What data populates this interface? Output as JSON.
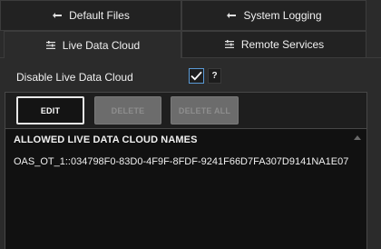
{
  "tabs": {
    "default_files": {
      "label": "Default Files",
      "icon": "gear-icon"
    },
    "system_logging": {
      "label": "System Logging",
      "icon": "gear-icon"
    },
    "live_data_cloud": {
      "label": "Live Data Cloud",
      "icon": "settings-lines-icon",
      "active": true
    },
    "remote_services": {
      "label": "Remote Services",
      "icon": "settings-lines-icon"
    }
  },
  "settings": {
    "disable_live_data_cloud_label": "Disable Live Data Cloud",
    "disable_live_data_cloud_checked": true,
    "help_label": "?"
  },
  "toolbar": {
    "edit_label": "EDIT",
    "delete_label": "DELETE",
    "delete_all_label": "DELETE ALL"
  },
  "list": {
    "header": "ALLOWED LIVE DATA CLOUD NAMES",
    "items": [
      "OAS_OT_1::034798F0-83D0-4F9F-8FDF-9241F66D7FA307D9141NA1E07"
    ]
  },
  "colors": {
    "background": "#2b2b2b",
    "tab_inactive": "#222222",
    "list_background": "#111111",
    "checkbox_border": "#5a9ad6",
    "button_disabled": "#6c6c6c"
  }
}
